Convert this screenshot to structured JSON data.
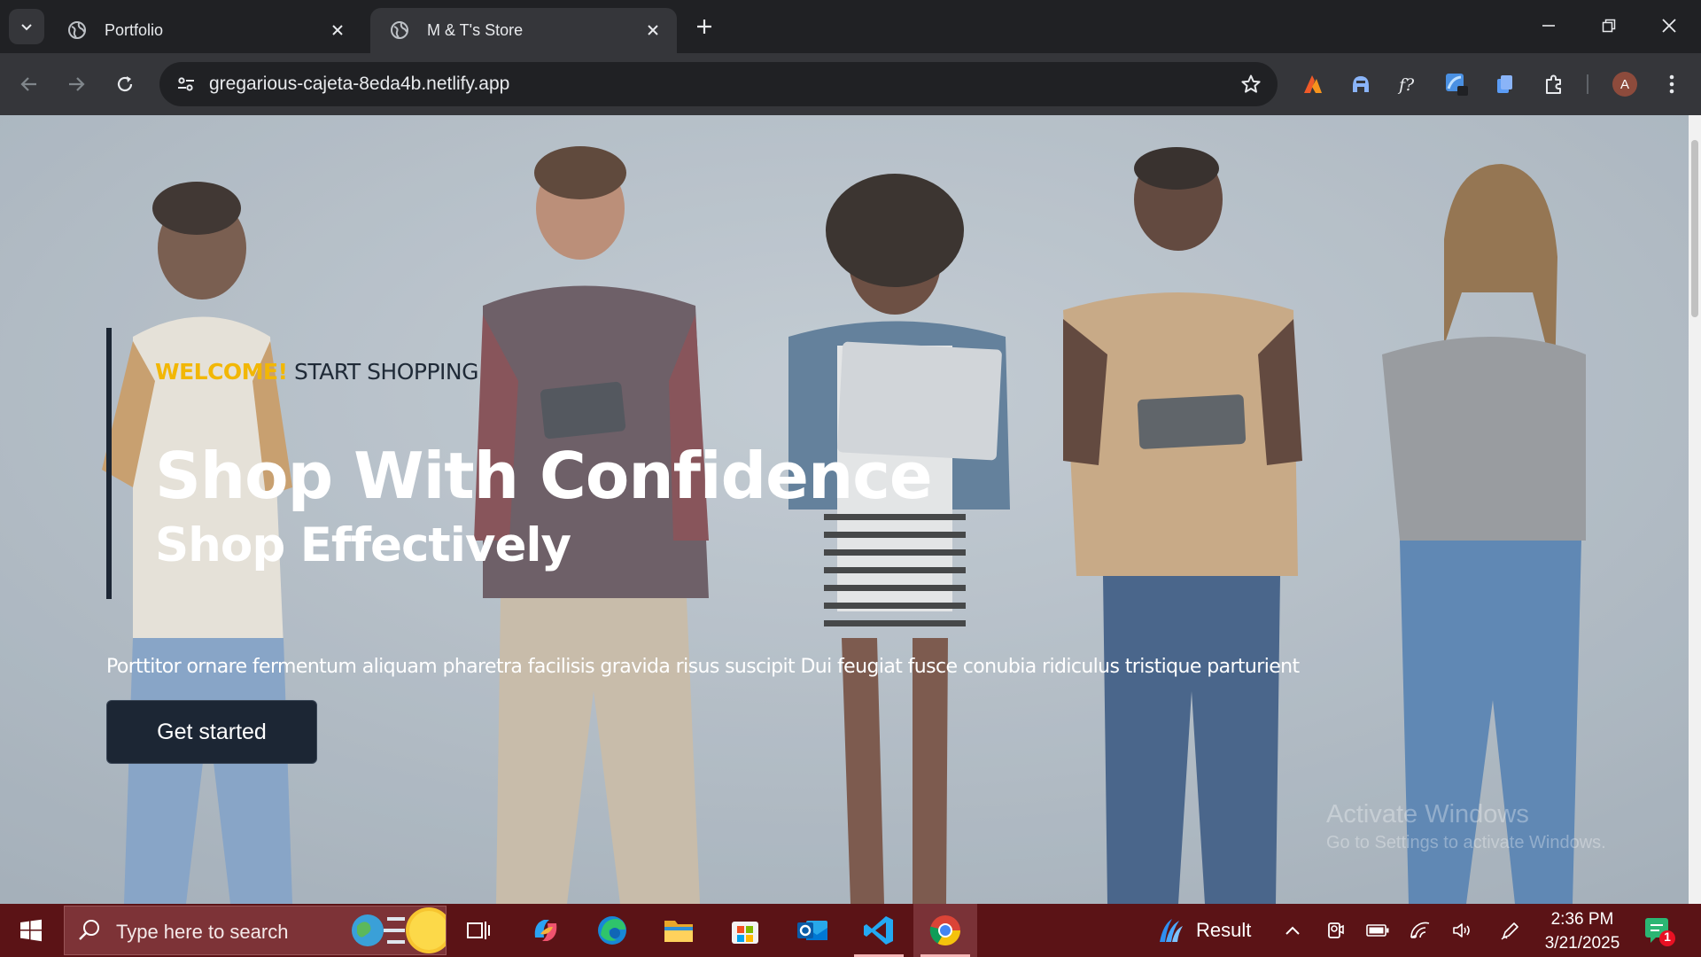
{
  "browser": {
    "tabs": [
      {
        "title": "Portfolio",
        "active": false
      },
      {
        "title": "M & T's Store",
        "active": true
      }
    ],
    "url": "gregarious-cajeta-8eda4b.netlify.app",
    "profile_initial": "A",
    "extensions": [
      "extension-fox-icon",
      "extension-helmet-icon",
      "extension-fx-icon",
      "extension-blue-square-icon",
      "extension-pages-icon",
      "extensions-puzzle-icon"
    ]
  },
  "hero": {
    "eyebrow_accent": "WELCOME!",
    "eyebrow_rest": " START SHOPPING",
    "heading": "Shop With Confidence",
    "subheading": "Shop Effectively",
    "description": "Porttitor ornare fermentum aliquam pharetra facilisis gravida risus suscipit Dui feugiat fusce conubia ridiculus tristique parturient",
    "cta_label": "Get started",
    "accent_color": "#f2b705",
    "dark_color": "#1c2634"
  },
  "watermark": {
    "line1": "Activate Windows",
    "line2": "Go to Settings to activate Windows."
  },
  "taskbar": {
    "search_placeholder": "Type here to search",
    "weather_label": "Result",
    "time": "2:36 PM",
    "date": "3/21/2025",
    "notification_count": "1",
    "color": "#5b1316"
  }
}
